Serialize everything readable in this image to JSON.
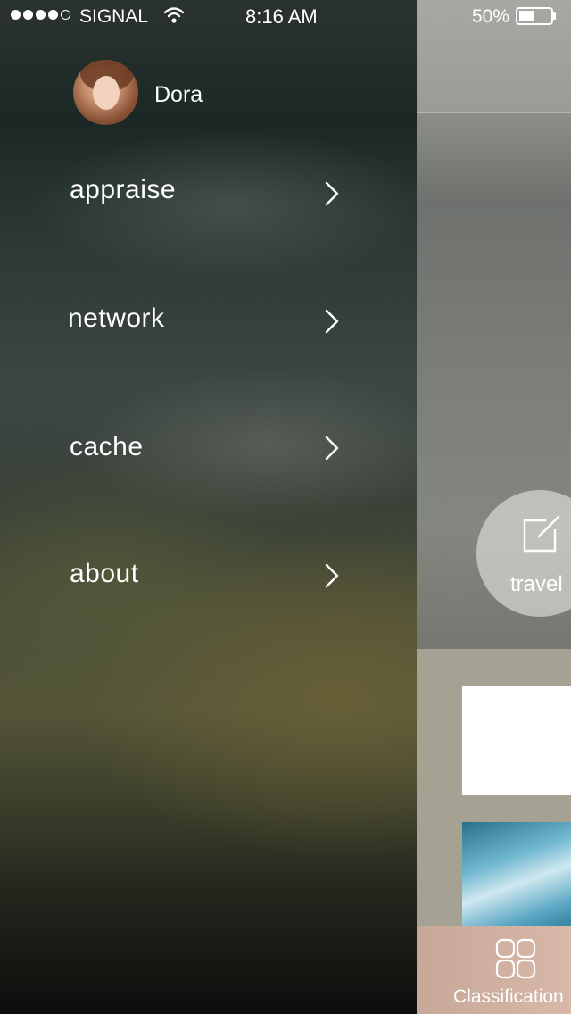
{
  "status_bar": {
    "signal_dots_filled": 4,
    "signal_dots_total": 5,
    "carrier": "SIGNAL",
    "time": "8:16 AM",
    "battery_percent": "50%",
    "battery_level": 0.5,
    "wifi_icon": "wifi-icon",
    "battery_icon": "battery-icon"
  },
  "drawer": {
    "profile": {
      "avatar_icon": "avatar",
      "name": "Dora"
    },
    "menu": [
      {
        "label": "appraise",
        "icon": "chevron-right-icon"
      },
      {
        "label": "network",
        "icon": "chevron-right-icon"
      },
      {
        "label": "cache",
        "icon": "chevron-right-icon"
      },
      {
        "label": "about",
        "icon": "chevron-right-icon"
      }
    ]
  },
  "content": {
    "fab": {
      "label": "travel",
      "icon": "edit-icon"
    },
    "tab_bar": {
      "label": "Classification",
      "icon": "grid-icon"
    }
  },
  "colors": {
    "text": "#ffffff",
    "tab_bar": "#d2b2a2",
    "fab": "#d7d7d2"
  }
}
